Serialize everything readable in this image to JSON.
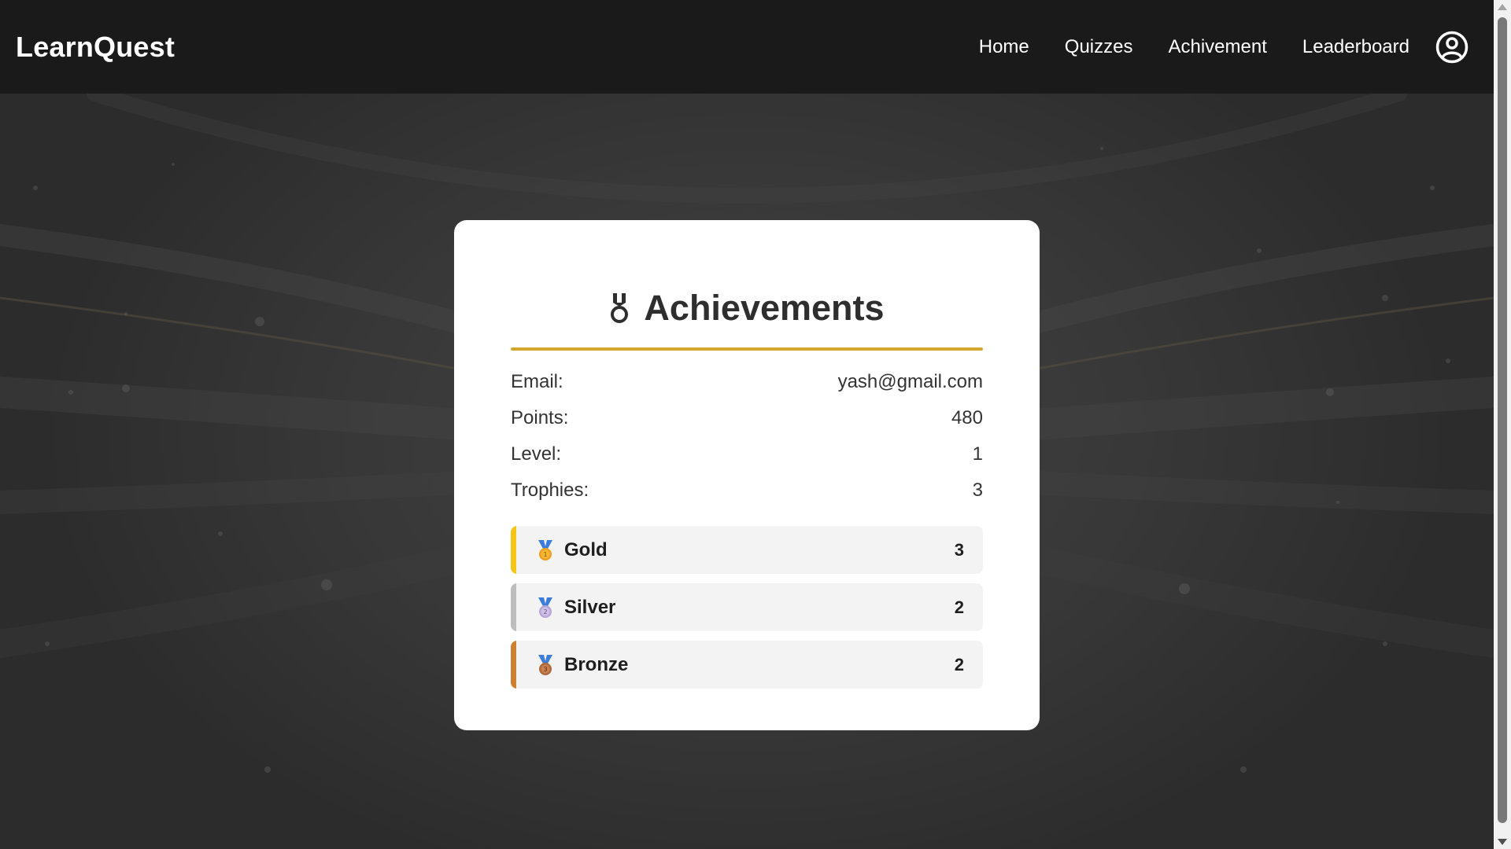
{
  "nav": {
    "brand": "LearnQuest",
    "links": [
      {
        "label": "Home"
      },
      {
        "label": "Quizzes"
      },
      {
        "label": "Achivement"
      },
      {
        "label": "Leaderboard"
      }
    ],
    "profile_icon": "user-circle-icon"
  },
  "card": {
    "title_icon": "medal-icon",
    "title": "Achievements",
    "rows": [
      {
        "label": "Email:",
        "value": "yash@gmail.com"
      },
      {
        "label": "Points:",
        "value": "480"
      },
      {
        "label": "Level:",
        "value": "1"
      },
      {
        "label": "Trophies:",
        "value": "3"
      }
    ],
    "medals": [
      {
        "icon": "gold-medal-icon",
        "name": "Gold",
        "count": "3",
        "color": "#f5c518"
      },
      {
        "icon": "silver-medal-icon",
        "name": "Silver",
        "count": "2",
        "color": "#bdbdbd"
      },
      {
        "icon": "bronze-medal-icon",
        "name": "Bronze",
        "count": "2",
        "color": "#cd7f32"
      }
    ]
  },
  "colors": {
    "navbar": "#1b1a1b",
    "accent_underline": "#d4a62e",
    "background": "#3a3a3a"
  }
}
